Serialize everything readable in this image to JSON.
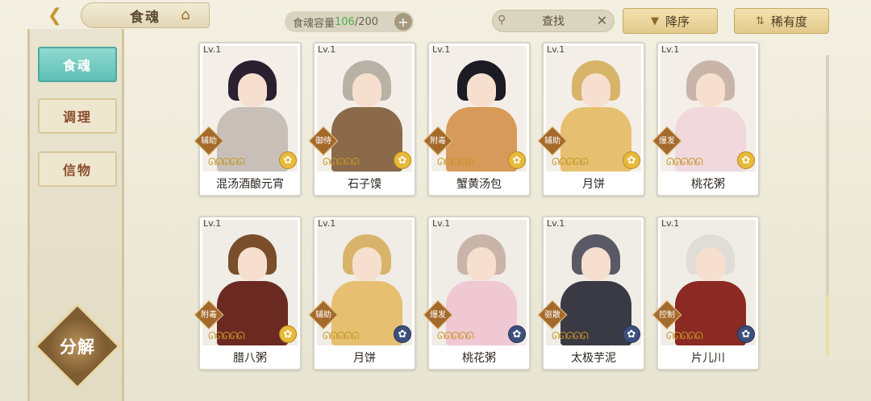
{
  "header": {
    "title": "食魂",
    "back_icon": "chevron-left-icon",
    "home_icon": "pagoda-icon",
    "capacity_label": "食魂容量",
    "capacity_current": "106",
    "capacity_total": "/200",
    "capacity_plus": "+",
    "search_placeholder": "查找",
    "sort_order_label": "降序",
    "sort_key_label": "稀有度"
  },
  "sidebar": {
    "tabs": [
      {
        "label": "食魂",
        "active": true
      },
      {
        "label": "调理",
        "active": false
      },
      {
        "label": "信物",
        "active": false
      }
    ],
    "decompose_label": "分解"
  },
  "cards": [
    {
      "level": "Lv.1",
      "name": "混汤酒酿元宵",
      "role": "辅助",
      "stars": "ᘏᘏᘏᘏᘏ",
      "medal": "gold",
      "hair": "#2a2030",
      "body": "#c8c0b8"
    },
    {
      "level": "Lv.1",
      "name": "石子馍",
      "role": "御侍",
      "stars": "ᘏᘏᘏᘏᘏ",
      "medal": "gold",
      "hair": "#b8b2a6",
      "body": "#8a6a4a"
    },
    {
      "level": "Lv.1",
      "name": "蟹黄汤包",
      "role": "附毒",
      "stars": "ᘏᘏᘏᘏᘏ",
      "medal": "gold",
      "hair": "#1c1a22",
      "body": "#d89a5a"
    },
    {
      "level": "Lv.1",
      "name": "月饼",
      "role": "辅助",
      "stars": "ᘏᘏᘏᘏᘏ",
      "medal": "gold",
      "hair": "#d8b46a",
      "body": "#e6c070"
    },
    {
      "level": "Lv.1",
      "name": "桃花粥",
      "role": "爆发",
      "stars": "ᘏᘏᘏᘏᘏ",
      "medal": "gold",
      "hair": "#c8b4a8",
      "body": "#f0d8dc"
    },
    {
      "level": "Lv.1",
      "name": "腊八粥",
      "role": "附毒",
      "stars": "ᘏᘏᘏᘏᘏ",
      "medal": "gold",
      "hair": "#7a4e2a",
      "body": "#6a2a22"
    },
    {
      "level": "Lv.1",
      "name": "月饼",
      "role": "辅助",
      "stars": "ᘏᘏᘏᘏᘏ",
      "medal": "blue",
      "hair": "#d8b46a",
      "body": "#e6c070"
    },
    {
      "level": "Lv.1",
      "name": "桃花粥",
      "role": "爆发",
      "stars": "ᘏᘏᘏᘏᘏ",
      "medal": "blue",
      "hair": "#c8b4a8",
      "body": "#f0c8d4"
    },
    {
      "level": "Lv.1",
      "name": "太极芋泥",
      "role": "驱散",
      "stars": "ᘏᘏᘏᘏᘏ",
      "medal": "blue",
      "hair": "#5a5a66",
      "body": "#3a3a44"
    },
    {
      "level": "Lv.1",
      "name": "片儿川",
      "role": "控制",
      "stars": "ᘏᘏᘏᘏᘏ",
      "medal": "blue",
      "hair": "#e0dcd8",
      "body": "#8a2a22"
    }
  ],
  "colors": {
    "active_tab": "#5fc0b6",
    "accent_gold": "#c8962e",
    "capacity_current": "#4fae4a"
  }
}
